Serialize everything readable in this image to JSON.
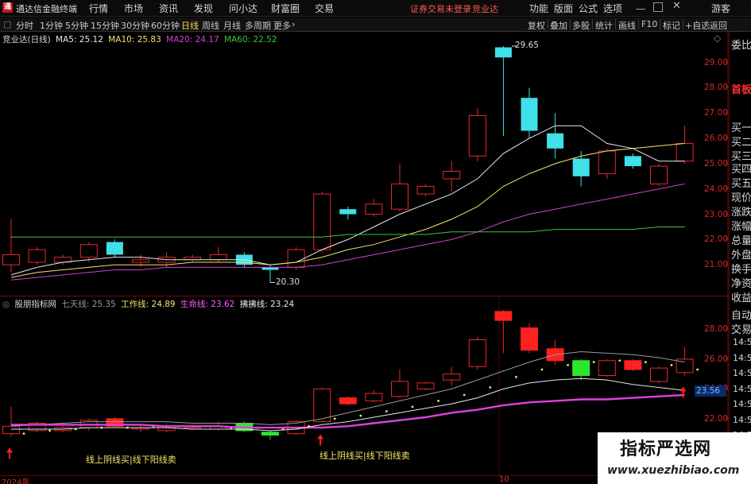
{
  "topbar": {
    "logo_glyph": "通",
    "app_title": "通达信金融终端",
    "menus": [
      "行情",
      "市场",
      "资讯",
      "发现",
      "问小达",
      "财富圈",
      "交易"
    ],
    "status_text": "证券交易未登录",
    "stock_name": "竞业达",
    "right_menus": [
      "功能",
      "版面",
      "公式",
      "选项"
    ],
    "guest": "游客"
  },
  "toolbar": {
    "periods": [
      "分时",
      "1分钟",
      "5分钟",
      "15分钟",
      "30分钟",
      "60分钟",
      "日线",
      "周线",
      "月线",
      "多周期",
      "更多"
    ],
    "active": "日线",
    "more_arrow": "›",
    "right_tools": [
      "复权",
      "叠加",
      "多股",
      "统计",
      "画线",
      "F10",
      "标记",
      "+自选",
      "返回"
    ]
  },
  "main_panel": {
    "title": "竞业达(日线)",
    "ma": [
      {
        "label": "MA5: 25.12",
        "color": "#e8e8e8"
      },
      {
        "label": "MA10: 25.83",
        "color": "#f5e36a"
      },
      {
        "label": "MA20: 24.17",
        "color": "#d040d0"
      },
      {
        "label": "MA60: 22.52",
        "color": "#3cc83c"
      }
    ],
    "y_ticks": [
      "29.00",
      "28.00",
      "27.00",
      "26.00",
      "25.00",
      "24.00",
      "23.00",
      "22.00",
      "21.00"
    ],
    "high_label": "29.65",
    "low_label": "20.30"
  },
  "sub_panel": {
    "title": "股朋指标网",
    "lines": [
      {
        "label": "七天线: 25.35",
        "color": "#9a9a9a"
      },
      {
        "label": "工作线: 24.89",
        "color": "#f5e36a"
      },
      {
        "label": "生命线: 23.62",
        "color": "#e040e0"
      },
      {
        "label": "拂拂线: 23.24",
        "color": "#e8e8e8"
      }
    ],
    "y_ticks": [
      "28.00",
      "26.00",
      "24.00",
      "22.00"
    ],
    "current_value": "23.56",
    "note_1": "线上阴线买|线下阳线卖",
    "note_2": "线上阴线买|线下阳线卖"
  },
  "right_panel": {
    "items": [
      "委比",
      "首板",
      "买一",
      "买二",
      "买三",
      "买四",
      "买五",
      "现价",
      "涨跌",
      "涨幅",
      "总量",
      "外盘",
      "换手",
      "净资",
      "收益",
      "自动",
      "交易"
    ],
    "hot": "首板",
    "times": [
      "14:55",
      "14:56",
      "14:56",
      "14:56",
      "14:56",
      "14:56",
      "14:56",
      "14:56"
    ]
  },
  "bottom_axis": {
    "year": "2024年",
    "month": "10"
  },
  "watermark": {
    "title": "指标严选网",
    "url": "www.xuezhibiao.com"
  },
  "chart_data": [
    {
      "type": "candlestick",
      "title": "竞业达(日线)",
      "ylim": [
        20.0,
        29.9
      ],
      "candles": [
        {
          "o": 21.0,
          "c": 21.4,
          "h": 22.8,
          "l": 20.7
        },
        {
          "o": 21.1,
          "c": 21.6,
          "h": 21.7,
          "l": 21.0
        },
        {
          "o": 21.1,
          "c": 21.3,
          "h": 21.4,
          "l": 21.0
        },
        {
          "o": 21.3,
          "c": 21.8,
          "h": 21.9,
          "l": 21.1
        },
        {
          "o": 21.9,
          "c": 21.4,
          "h": 22.0,
          "l": 21.3
        },
        {
          "o": 21.1,
          "c": 21.2,
          "h": 21.4,
          "l": 20.9
        },
        {
          "o": 21.1,
          "c": 21.3,
          "h": 21.5,
          "l": 20.9
        },
        {
          "o": 21.2,
          "c": 21.3,
          "h": 21.4,
          "l": 21.1
        },
        {
          "o": 21.2,
          "c": 21.4,
          "h": 21.7,
          "l": 21.1
        },
        {
          "o": 21.4,
          "c": 21.0,
          "h": 21.5,
          "l": 20.9
        },
        {
          "o": 20.9,
          "c": 20.8,
          "h": 21.0,
          "l": 20.3
        },
        {
          "o": 20.9,
          "c": 21.6,
          "h": 21.7,
          "l": 20.8
        },
        {
          "o": 21.6,
          "c": 23.8,
          "h": 23.9,
          "l": 21.5
        },
        {
          "o": 23.2,
          "c": 23.0,
          "h": 23.3,
          "l": 22.8
        },
        {
          "o": 23.0,
          "c": 23.4,
          "h": 23.6,
          "l": 22.9
        },
        {
          "o": 23.2,
          "c": 24.2,
          "h": 25.0,
          "l": 23.1
        },
        {
          "o": 23.8,
          "c": 24.1,
          "h": 24.2,
          "l": 23.7
        },
        {
          "o": 24.4,
          "c": 24.7,
          "h": 25.1,
          "l": 23.9
        },
        {
          "o": 25.3,
          "c": 26.9,
          "h": 27.2,
          "l": 25.1
        },
        {
          "o": 29.6,
          "c": 29.2,
          "h": 29.65,
          "l": 26.1
        },
        {
          "o": 27.6,
          "c": 26.3,
          "h": 28.0,
          "l": 26.0
        },
        {
          "o": 26.2,
          "c": 25.6,
          "h": 27.0,
          "l": 25.2
        },
        {
          "o": 25.2,
          "c": 24.5,
          "h": 25.5,
          "l": 24.1
        },
        {
          "o": 24.6,
          "c": 25.5,
          "h": 25.6,
          "l": 24.4
        },
        {
          "o": 25.3,
          "c": 24.9,
          "h": 25.4,
          "l": 24.8
        },
        {
          "o": 24.2,
          "c": 24.9,
          "h": 25.0,
          "l": 24.1
        },
        {
          "o": 25.1,
          "c": 25.8,
          "h": 26.5,
          "l": 25.0
        }
      ],
      "series": [
        {
          "name": "MA5",
          "color": "#e8e8e8",
          "values": [
            20.6,
            20.9,
            21.1,
            21.2,
            21.3,
            21.3,
            21.2,
            21.2,
            21.2,
            21.2,
            21.0,
            21.1,
            21.6,
            22.0,
            22.5,
            23.0,
            23.4,
            23.8,
            24.4,
            25.4,
            26.0,
            26.5,
            26.5,
            25.8,
            25.6,
            25.1,
            25.1
          ]
        },
        {
          "name": "MA10",
          "color": "#f5e36a",
          "values": [
            20.5,
            20.7,
            20.8,
            20.9,
            21.0,
            21.0,
            21.0,
            21.1,
            21.1,
            21.1,
            21.0,
            21.1,
            21.3,
            21.6,
            21.8,
            22.1,
            22.4,
            22.8,
            23.3,
            24.1,
            24.6,
            25.0,
            25.3,
            25.5,
            25.6,
            25.7,
            25.8
          ]
        },
        {
          "name": "MA20",
          "color": "#d040d0",
          "values": [
            20.4,
            20.5,
            20.6,
            20.7,
            20.8,
            20.8,
            20.9,
            20.9,
            20.9,
            20.9,
            20.9,
            20.9,
            21.0,
            21.2,
            21.4,
            21.6,
            21.8,
            22.0,
            22.3,
            22.7,
            23.0,
            23.2,
            23.4,
            23.6,
            23.8,
            24.0,
            24.2
          ]
        },
        {
          "name": "MA60",
          "color": "#3cc83c",
          "values": [
            22.1,
            22.1,
            22.1,
            22.1,
            22.1,
            22.1,
            22.1,
            22.1,
            22.1,
            22.1,
            22.1,
            22.1,
            22.1,
            22.2,
            22.2,
            22.2,
            22.2,
            22.3,
            22.3,
            22.3,
            22.3,
            22.4,
            22.4,
            22.4,
            22.4,
            22.5,
            22.5
          ]
        }
      ]
    },
    {
      "type": "candlestick",
      "title": "股朋指标网",
      "ylim": [
        20.5,
        29.3
      ],
      "candles": [
        {
          "o": 21.0,
          "c": 21.5,
          "h": 22.8,
          "l": 20.8
        },
        {
          "o": 21.2,
          "c": 21.7,
          "h": 21.8,
          "l": 21.1
        },
        {
          "o": 21.2,
          "c": 21.4,
          "h": 21.5,
          "l": 21.1
        },
        {
          "o": 21.4,
          "c": 21.9,
          "h": 22.0,
          "l": 21.2
        },
        {
          "o": 22.0,
          "c": 21.5,
          "h": 22.1,
          "l": 21.4
        },
        {
          "o": 21.3,
          "c": 21.4,
          "h": 21.6,
          "l": 21.1
        },
        {
          "o": 21.2,
          "c": 21.5,
          "h": 21.7,
          "l": 21.1
        },
        {
          "o": 21.4,
          "c": 21.5,
          "h": 21.6,
          "l": 21.3
        },
        {
          "o": 21.3,
          "c": 21.5,
          "h": 21.8,
          "l": 21.2
        },
        {
          "o": 21.7,
          "c": 21.2,
          "h": 21.8,
          "l": 21.1
        },
        {
          "o": 21.1,
          "c": 20.9,
          "h": 21.2,
          "l": 20.6
        },
        {
          "o": 21.0,
          "c": 21.8,
          "h": 21.9,
          "l": 20.9
        },
        {
          "o": 21.8,
          "c": 24.0,
          "h": 24.1,
          "l": 21.7
        },
        {
          "o": 23.4,
          "c": 23.0,
          "h": 23.5,
          "l": 22.9
        },
        {
          "o": 23.2,
          "c": 23.7,
          "h": 23.9,
          "l": 23.1
        },
        {
          "o": 23.5,
          "c": 24.5,
          "h": 25.3,
          "l": 23.4
        },
        {
          "o": 24.0,
          "c": 24.4,
          "h": 24.5,
          "l": 23.9
        },
        {
          "o": 24.6,
          "c": 25.0,
          "h": 25.5,
          "l": 24.2
        },
        {
          "o": 25.5,
          "c": 27.3,
          "h": 27.5,
          "l": 25.3
        },
        {
          "o": 29.2,
          "c": 28.6,
          "h": 29.3,
          "l": 26.4
        },
        {
          "o": 28.1,
          "c": 26.6,
          "h": 28.4,
          "l": 26.4
        },
        {
          "o": 26.7,
          "c": 25.9,
          "h": 27.3,
          "l": 25.6
        },
        {
          "o": 25.9,
          "c": 24.9,
          "h": 26.0,
          "l": 24.6
        },
        {
          "o": 24.9,
          "c": 25.9,
          "h": 26.0,
          "l": 24.8
        },
        {
          "o": 25.9,
          "c": 25.3,
          "h": 26.0,
          "l": 25.2
        },
        {
          "o": 24.5,
          "c": 25.4,
          "h": 25.5,
          "l": 24.4
        },
        {
          "o": 25.1,
          "c": 26.0,
          "h": 26.8,
          "l": 24.9
        }
      ],
      "series": [
        {
          "name": "七天线",
          "color": "#9a9a9a",
          "values": [
            21.5,
            21.6,
            21.7,
            21.8,
            21.8,
            21.8,
            21.8,
            21.7,
            21.7,
            21.7,
            21.6,
            21.7,
            22.0,
            22.4,
            22.8,
            23.2,
            23.6,
            24.0,
            24.6,
            25.2,
            25.8,
            26.3,
            26.5,
            26.4,
            26.3,
            26.1,
            25.8
          ]
        },
        {
          "name": "工作线",
          "color": "#f5e36a",
          "values": [
            21.0,
            21.2,
            21.3,
            21.4,
            21.4,
            21.5,
            21.5,
            21.5,
            21.4,
            21.4,
            21.3,
            21.5,
            22.0,
            22.2,
            22.5,
            22.8,
            23.2,
            23.6,
            24.1,
            24.8,
            25.3,
            25.6,
            25.8,
            25.9,
            25.8,
            25.6,
            25.3
          ]
        },
        {
          "name": "生命线",
          "color": "#e040e0",
          "values": [
            21.6,
            21.6,
            21.6,
            21.6,
            21.6,
            21.6,
            21.5,
            21.5,
            21.5,
            21.4,
            21.4,
            21.4,
            21.4,
            21.5,
            21.7,
            21.9,
            22.1,
            22.4,
            22.6,
            22.9,
            23.1,
            23.2,
            23.3,
            23.3,
            23.4,
            23.5,
            23.6
          ]
        },
        {
          "name": "拂拂线",
          "color": "#e8e8e8",
          "values": [
            21.3,
            21.3,
            21.3,
            21.4,
            21.4,
            21.4,
            21.4,
            21.3,
            21.3,
            21.3,
            21.2,
            21.3,
            21.6,
            21.8,
            22.1,
            22.4,
            22.7,
            23.0,
            23.4,
            24.0,
            24.4,
            24.6,
            24.7,
            24.6,
            24.3,
            24.1,
            23.9
          ]
        }
      ],
      "signals": [
        0,
        12,
        26
      ]
    }
  ]
}
